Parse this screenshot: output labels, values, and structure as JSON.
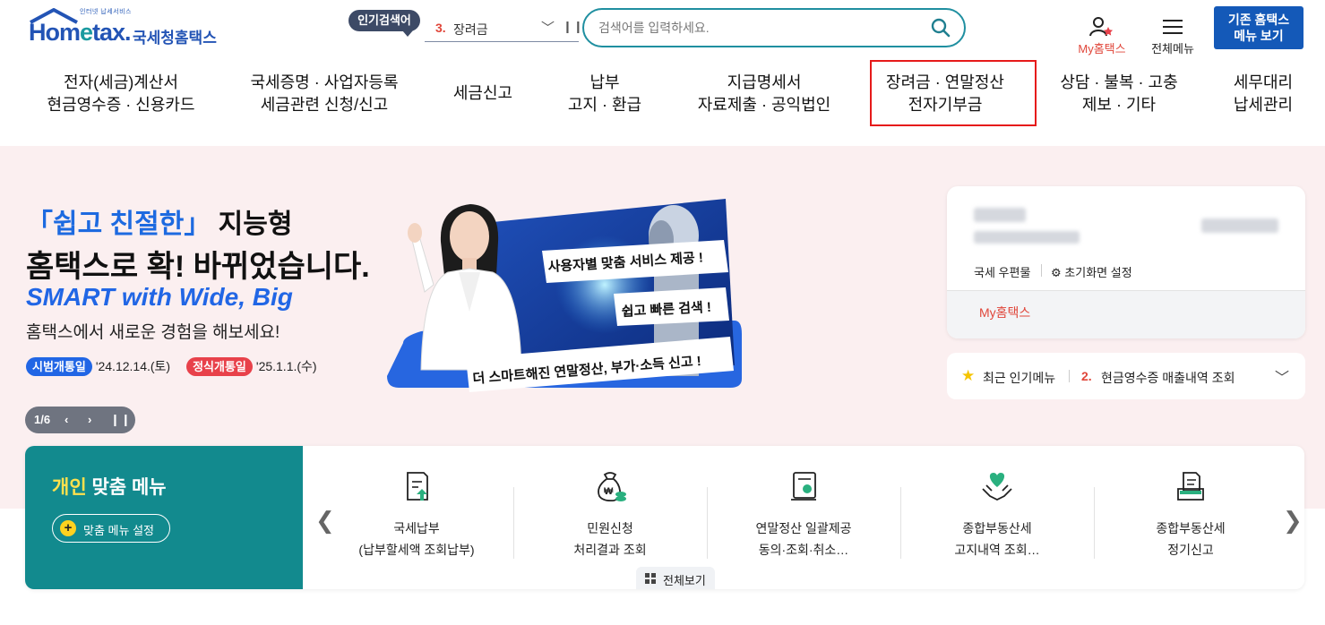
{
  "logo": {
    "small": "인터넷 납세서비스",
    "word_a": "Hom",
    "word_e": "e",
    "word_b": "tax.",
    "korean": "국세청홈택스"
  },
  "popular": {
    "badge": "인기검색어",
    "rank": "3.",
    "term": "장려금"
  },
  "search": {
    "placeholder": "검색어를 입력하세요."
  },
  "header": {
    "myhometax": "My홈택스",
    "allmenu": "전체메뉴",
    "old_menu_1": "기존 홈택스",
    "old_menu_2": "메뉴 보기"
  },
  "nav": [
    {
      "l1": "전자(세금)계산서",
      "l2": "현금영수증 · 신용카드"
    },
    {
      "l1": "국세증명 · 사업자등록",
      "l2": "세금관련 신청/신고"
    },
    {
      "l1": "세금신고",
      "l2": ""
    },
    {
      "l1": "납부",
      "l2": "고지 · 환급"
    },
    {
      "l1": "지급명세서",
      "l2": "자료제출 · 공익법인"
    },
    {
      "l1": "장려금 · 연말정산",
      "l2": "전자기부금"
    },
    {
      "l1": "상담 · 불복 · 고충",
      "l2": "제보 · 기타"
    },
    {
      "l1": "세무대리",
      "l2": "납세관리"
    }
  ],
  "banner": {
    "line1_quote": "「쉽고 친절한」",
    "line1_rest": " 지능형",
    "line2": "홈택스로 확! 바뀌었습니다.",
    "line3": "SMART with Wide, Big",
    "line4": "홈택스에서 새로운 경험을 해보세요!",
    "pilot_label": "시범개통일",
    "pilot_date": "'24.12.14.(토)",
    "official_label": "정식개통일",
    "official_date": "'25.1.1.(수)",
    "bubble1": "사용자별 맞춤 서비스 제공 !",
    "bubble2": "쉽고 빠른 검색 !",
    "bubble3": "더 스마트해진 연말정산, 부가·소득 신고 !",
    "slide": "1/6"
  },
  "card": {
    "mail": "국세 우편물",
    "setting": "초기화면 설정",
    "myhometax": "My홈택스"
  },
  "recent": {
    "label": "최근 인기메뉴",
    "rank": "2.",
    "item": "현금영수증 매출내역 조회"
  },
  "custom_menu": {
    "title_hl": "개인",
    "title_rest": " 맞춤 메뉴",
    "set_button": "맞춤 메뉴 설정",
    "view_all": "전체보기",
    "items": [
      {
        "l1": "국세납부",
        "l2": "(납부할세액 조회납부)",
        "icon": "tax-payment-icon"
      },
      {
        "l1": "민원신청",
        "l2": "처리결과 조회",
        "icon": "civil-petition-icon"
      },
      {
        "l1": "연말정산 일괄제공",
        "l2": "동의·조회·취소…",
        "icon": "year-end-settlement-icon"
      },
      {
        "l1": "종합부동산세",
        "l2": "고지내역 조회…",
        "icon": "property-tax-notice-icon"
      },
      {
        "l1": "종합부동산세",
        "l2": "정기신고",
        "icon": "property-tax-filing-icon"
      }
    ]
  },
  "colors": {
    "brand_blue": "#2354b5",
    "teal": "#128a8e",
    "accent_red": "#e0463a",
    "banner_bg": "#fbeff0",
    "highlight_red": "#e61a1a"
  }
}
